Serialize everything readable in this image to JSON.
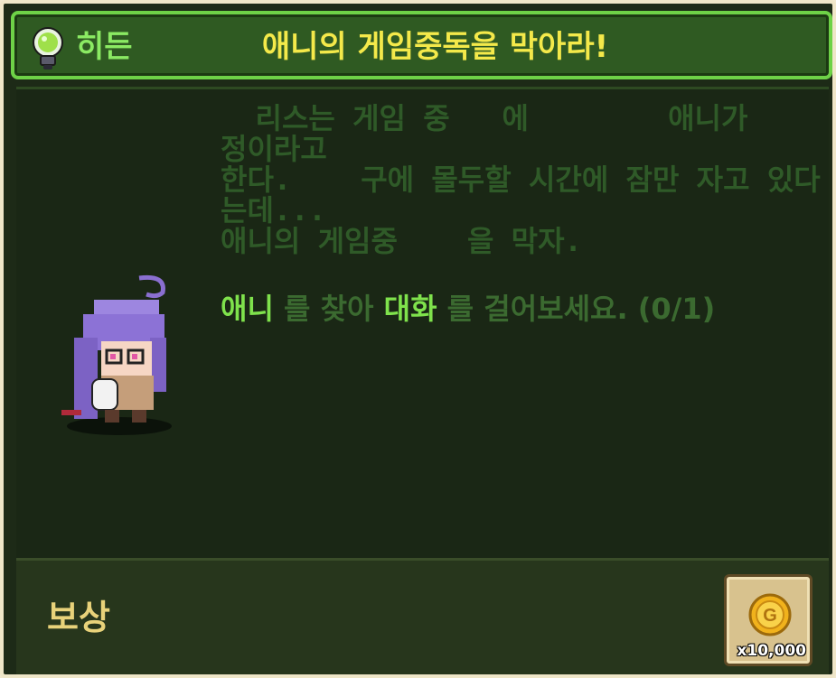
{
  "header": {
    "type_label": "히든",
    "title": "애니의 게임중독을 막아라!"
  },
  "description": "  리스는 게임 중   에        애니가     정이라고\n한다.    구에 몰두할 시간에 잠만 자고 있다는데...\n애니의 게임중    을 막자.",
  "objective": {
    "target": "애니",
    "part1": " 를 찾아 ",
    "action": "대화",
    "part2": " 를 걸어보세요. (0/1)"
  },
  "reward": {
    "label": "보상",
    "amount": "x10,000",
    "icon": "gold-coin-icon"
  },
  "colors": {
    "title": "#f4e94a",
    "highlight": "#7fe24c",
    "muted_text": "#2f5a28"
  }
}
